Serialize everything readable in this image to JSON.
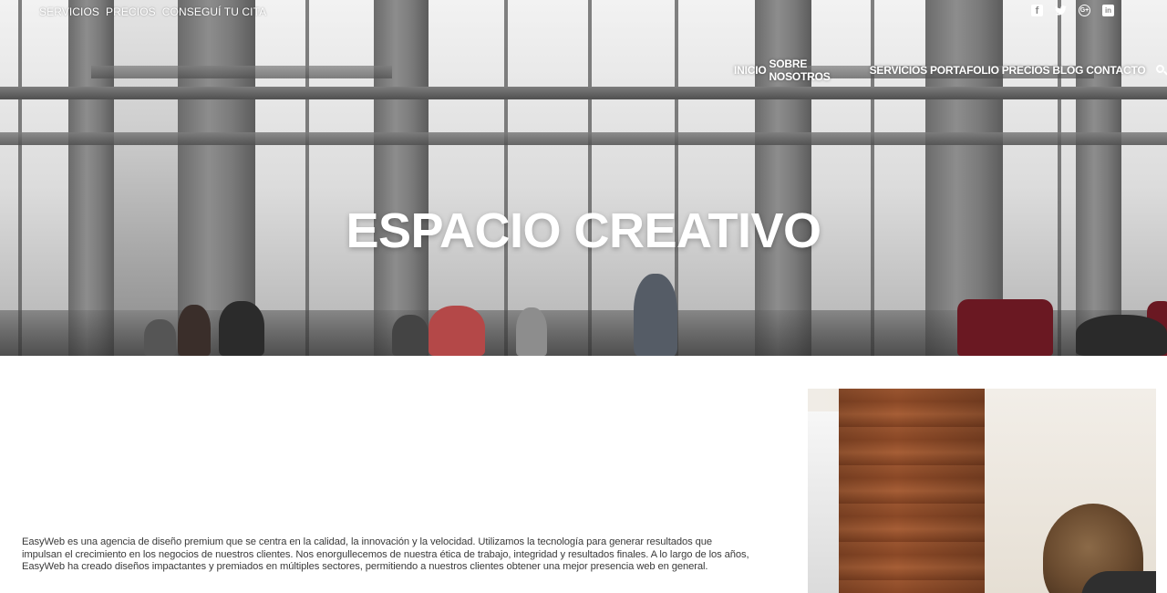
{
  "top_links": [
    "SERVICIOS",
    "PRECIOS",
    "CONSEGUÍ TU CITA"
  ],
  "social_icons": [
    "facebook-icon",
    "twitter-icon",
    "google-plus-icon",
    "linkedin-icon"
  ],
  "nav": {
    "items": [
      "INICIO",
      "SOBRE NOSOTROS",
      "SERVICIOS",
      "PORTAFOLIO",
      "PRECIOS",
      "BLOG",
      "CONTACTO"
    ],
    "search_icon": "search-icon"
  },
  "hero": {
    "title": "ESPACIO CREATIVO"
  },
  "about": {
    "text": "EasyWeb es una agencia de diseño premium que se centra en la calidad, la innovación y la velocidad. Utilizamos la tecnología para generar resultados que impulsan el crecimiento en los negocios de nuestros clientes. Nos enorgullecemos de nuestra ética de trabajo, integridad y resultados finales. A lo largo de los años, EasyWeb ha creado diseños impactantes y premiados en múltiples sectores, permitiendo a nuestros clientes obtener una mejor presencia web en general."
  },
  "colors": {
    "nav_text": "#ffffff",
    "body_text": "#3a3a3a",
    "chair": "#6a1822"
  }
}
